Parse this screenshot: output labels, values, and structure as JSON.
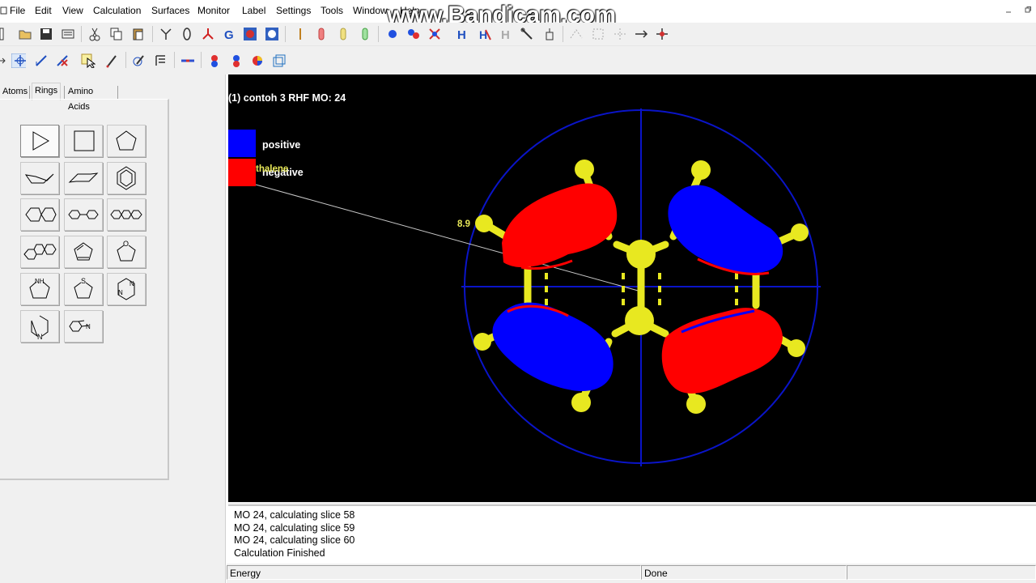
{
  "menu": {
    "items": [
      "File",
      "Edit",
      "View",
      "Calculation",
      "Surfaces",
      "Monitor",
      "Label",
      "Settings",
      "Tools",
      "Window",
      "Help"
    ]
  },
  "watermark": "www.Bandicam.com",
  "left_panel": {
    "tabs": [
      "Atoms",
      "Rings",
      "Amino Acids"
    ],
    "active_tab": "Rings",
    "ring_buttons": [
      "cyclopropane",
      "cyclobutane",
      "cyclopentane",
      "cyclohexane-chair",
      "cyclohexane-boat",
      "benzene",
      "naphthalene",
      "biphenyl",
      "anthracene",
      "phenanthrene",
      "cyclopentadiene",
      "furan",
      "pyrrole",
      "thiophene",
      "pyrimidine",
      "pyridine",
      "indole"
    ]
  },
  "viewer": {
    "title": "(1) contoh 3 RHF MO: 24",
    "legend": [
      {
        "label": "positive",
        "color": "#0000ff"
      },
      {
        "label": "negative",
        "color": "#ff0000"
      }
    ],
    "overlay_text": "thalene",
    "distance_label": "8.9",
    "background": "#000000",
    "atom_color": "#f5f532"
  },
  "log": {
    "lines": [
      "MO 24, calculating slice 58",
      "MO 24, calculating slice 59",
      "MO 24, calculating slice 60",
      "Calculation Finished"
    ]
  },
  "status": {
    "left": "Energy",
    "middle": "Done",
    "right": ""
  }
}
